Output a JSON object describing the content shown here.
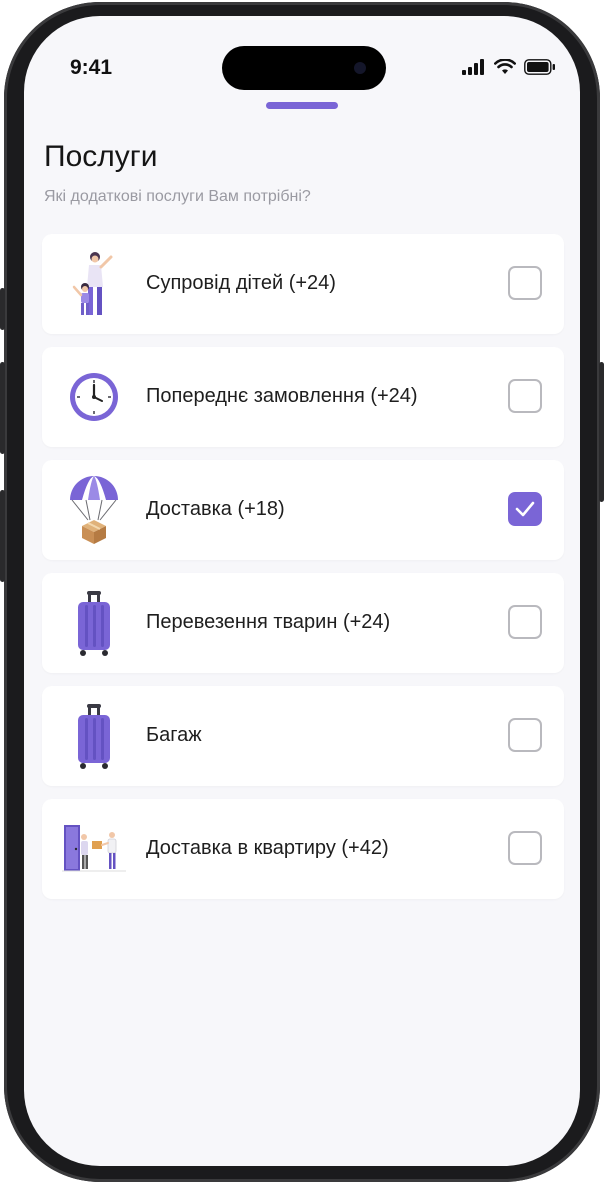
{
  "status_bar": {
    "time": "9:41",
    "icons": [
      "signal-icon",
      "wifi-icon",
      "battery-icon"
    ]
  },
  "page": {
    "title": "Послуги",
    "subtitle": "Які додаткові послуги Вам потрібні?"
  },
  "services": [
    {
      "label": "Супровід дітей (+24)",
      "icon": "child-escort-icon",
      "checked": false
    },
    {
      "label": "Попереднє замовлення (+24)",
      "icon": "clock-icon",
      "checked": false
    },
    {
      "label": "Доставка (+18)",
      "icon": "parachute-parcel-icon",
      "checked": true
    },
    {
      "label": "Перевезення тварин (+24)",
      "icon": "suitcase-icon",
      "checked": false
    },
    {
      "label": "Багаж",
      "icon": "suitcase-icon",
      "checked": false
    },
    {
      "label": "Доставка в квартиру (+42)",
      "icon": "door-delivery-icon",
      "checked": false
    }
  ],
  "colors": {
    "accent": "#7a65d6",
    "background": "#f7f7fa",
    "card": "#ffffff",
    "subtitle": "#9a9aa2"
  }
}
